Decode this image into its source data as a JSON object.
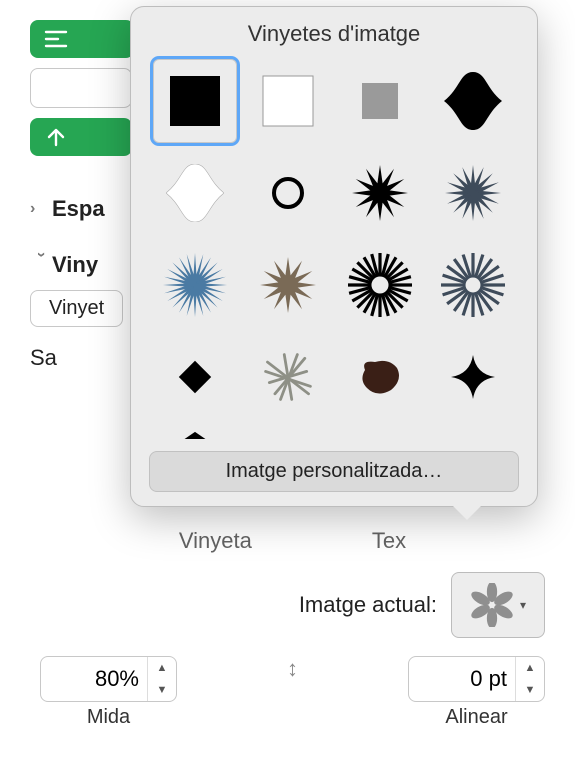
{
  "popover": {
    "title": "Vinyetes d'imatge",
    "custom_button": "Imatge personalitzada…"
  },
  "sidebar": {
    "spacing_section": "Espa",
    "bullets_section": "Viny",
    "bullets_select": "Vinyet",
    "indent_label": "Sa"
  },
  "mid_labels": {
    "bullet": "Vinyeta",
    "text": "Tex"
  },
  "current": {
    "label": "Imatge actual:"
  },
  "size": {
    "value": "80%",
    "label": "Mida"
  },
  "align": {
    "value": "0 pt",
    "label": "Alinear"
  }
}
